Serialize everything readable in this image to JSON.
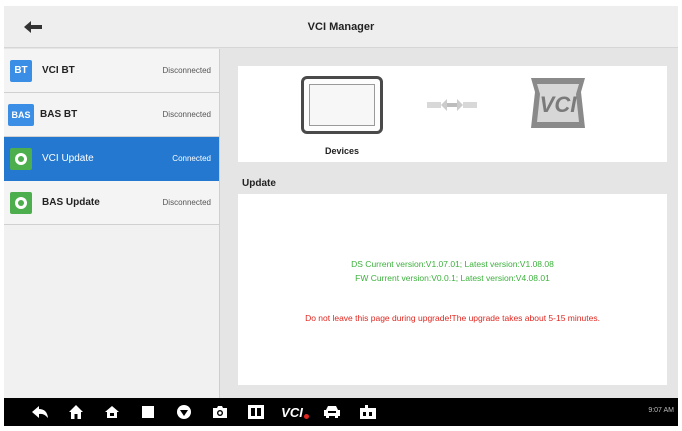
{
  "header": {
    "title": "VCI Manager",
    "back_icon": "back-arrow-icon"
  },
  "sidebar": {
    "items": [
      {
        "badge": "BT",
        "label": "VCI BT",
        "status": "Disconnected",
        "badge_color": "#3a8ee6",
        "active": false
      },
      {
        "badge": "BAS",
        "label": "BAS BT",
        "status": "Disconnected",
        "badge_color": "#3a8ee6",
        "active": false
      },
      {
        "badge": "",
        "label": "VCI Update",
        "status": "Connected",
        "badge_color": "#4cae4c",
        "active": true
      },
      {
        "badge": "",
        "label": "BAS Update",
        "status": "Disconnected",
        "badge_color": "#4cae4c",
        "active": false
      }
    ]
  },
  "devices": {
    "label": "Devices",
    "logo_text": "VCI"
  },
  "update": {
    "header": "Update",
    "ds_version": "DS Current version:V1.07.01; Latest version:V1.08.08",
    "fw_version": "FW Current version:V0.0.1; Latest version:V4.08.01",
    "warning": "Do not leave this page during upgrade!The upgrade takes about 5-15 minutes."
  },
  "navbar": {
    "icons": [
      "back-icon",
      "home-icon",
      "house-icon",
      "recent-apps-icon",
      "browser-icon",
      "camera-icon",
      "screenshot-icon",
      "vci-icon",
      "car-icon",
      "shop-icon"
    ],
    "vci_label": "VCI",
    "status_text": "9:07 AM"
  },
  "colors": {
    "accent": "#2478d0",
    "version_green": "#3cb13c",
    "warning_red": "#e0261f"
  }
}
